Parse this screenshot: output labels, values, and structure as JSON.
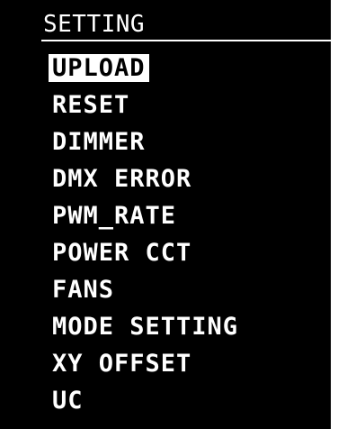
{
  "screen": {
    "title": "SETTING",
    "selected_index": 0
  },
  "menu": {
    "items": [
      {
        "label": "UPLOAD",
        "selected": true
      },
      {
        "label": "RESET",
        "selected": false
      },
      {
        "label": "DIMMER",
        "selected": false
      },
      {
        "label": "DMX ERROR",
        "selected": false
      },
      {
        "label": "PWM_RATE",
        "selected": false
      },
      {
        "label": "POWER CCT",
        "selected": false
      },
      {
        "label": "FANS",
        "selected": false
      },
      {
        "label": "MODE SETTING",
        "selected": false
      },
      {
        "label": "XY OFFSET",
        "selected": false
      },
      {
        "label": "UC",
        "selected": false
      }
    ]
  },
  "colors": {
    "background": "#000000",
    "foreground": "#ffffff",
    "highlight": "#ffffff"
  }
}
